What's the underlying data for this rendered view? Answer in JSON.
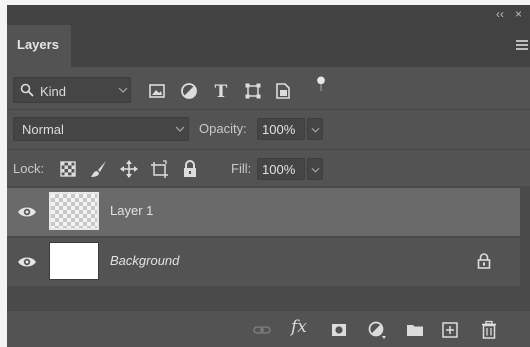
{
  "window": {
    "collapse_label": "‹‹",
    "close_label": "×"
  },
  "tab": {
    "label": "Layers"
  },
  "filter": {
    "kind_label": "Kind",
    "icons": [
      "image-filter-icon",
      "adjustment-filter-icon",
      "type-filter-icon",
      "shape-filter-icon",
      "smart-object-filter-icon",
      "filter-toggle-icon"
    ]
  },
  "blend": {
    "mode": "Normal",
    "opacity_label": "Opacity:",
    "opacity_value": "100%"
  },
  "lock": {
    "label": "Lock:",
    "icons": [
      "lock-transparent-pixels-icon",
      "lock-image-pixels-icon",
      "lock-position-icon",
      "lock-artboard-icon",
      "lock-all-icon"
    ],
    "fill_label": "Fill:",
    "fill_value": "100%"
  },
  "layers": [
    {
      "name": "Layer 1",
      "selected": true,
      "visible": true,
      "locked": false,
      "transparent": true
    },
    {
      "name": "Background",
      "selected": false,
      "visible": true,
      "locked": true,
      "transparent": false
    }
  ],
  "footer": {
    "icons": [
      "link-layers-icon",
      "layer-style-icon",
      "add-mask-icon",
      "new-fill-adjustment-icon",
      "new-group-icon",
      "new-layer-icon",
      "delete-layer-icon"
    ],
    "fx_label": "fx"
  },
  "colors": {
    "panel_bg": "#535353",
    "header_bg": "#424242",
    "selected_row": "#6a6a6a",
    "text": "#d6d6d6"
  }
}
